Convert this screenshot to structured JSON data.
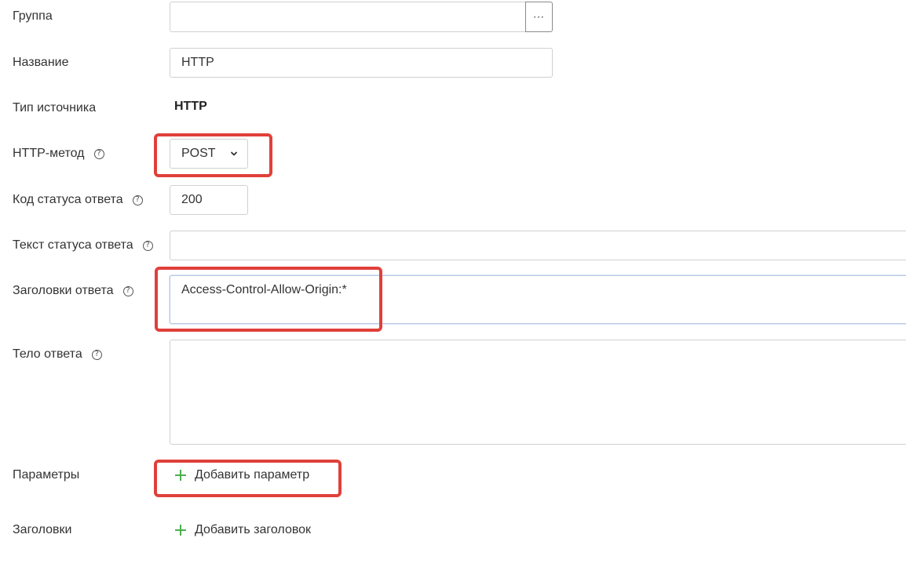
{
  "form": {
    "group": {
      "label": "Группа",
      "value": "",
      "browse_button": "···"
    },
    "name": {
      "label": "Название",
      "value": "HTTP"
    },
    "source_type": {
      "label": "Тип источника",
      "value": "HTTP"
    },
    "http_method": {
      "label": "HTTP-метод",
      "help": "?",
      "value": "POST",
      "icon": "chevron-down-icon"
    },
    "status_code": {
      "label": "Код статуса ответа",
      "help": "?",
      "value": "200"
    },
    "status_text": {
      "label": "Текст статуса ответа",
      "help": "?",
      "value": ""
    },
    "response_headers": {
      "label": "Заголовки ответа",
      "help": "?",
      "value": "Access-Control-Allow-Origin:*"
    },
    "response_body": {
      "label": "Тело ответа",
      "help": "?",
      "value": ""
    },
    "parameters": {
      "label": "Параметры",
      "add_label": "Добавить параметр",
      "icon": "plus-icon"
    },
    "headers": {
      "label": "Заголовки",
      "add_label": "Добавить заголовок",
      "icon": "plus-icon"
    }
  },
  "colors": {
    "highlight": "#e0403a",
    "plus": "#4caf50",
    "focus_border": "#b8c8e6"
  }
}
